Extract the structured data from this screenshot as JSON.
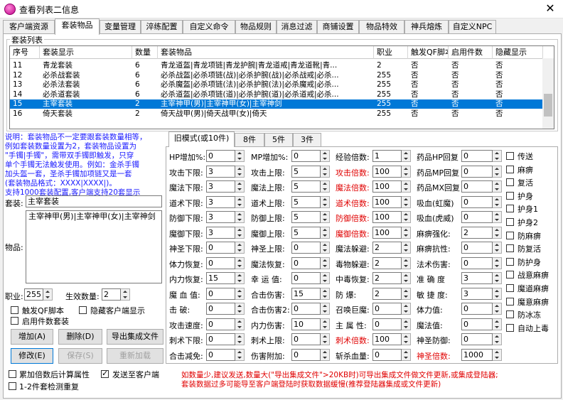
{
  "window": {
    "title": "查看列表二信息",
    "close": "✕"
  },
  "tabs": [
    "客户端资源",
    "套装物品",
    "变量管理",
    "淬练配置",
    "自定义命令",
    "物品规则",
    "消息过滤",
    "商铺设置",
    "物品特效",
    "神兵熔炼",
    "自定义NPC"
  ],
  "active_tab": "套装物品",
  "suit_list": {
    "title": "套装列表",
    "columns": [
      "序号",
      "套装显示",
      "数量",
      "套装物品",
      "职业",
      "触发QF脚本",
      "启用件数",
      "隐藏显示"
    ],
    "rows": [
      {
        "id": "11",
        "name": "青龙套装",
        "count": "6",
        "items": "青龙道盔|青龙项链|青龙护腕|青龙道戒|青龙道靴|青...",
        "job": "2",
        "qf": "否",
        "enable": "否",
        "hide": "否",
        "selected": false
      },
      {
        "id": "12",
        "name": "必杀战套装",
        "count": "6",
        "items": "必杀战盔|必杀项链(战)|必杀护腕(战)|必杀战戒|必杀...",
        "job": "255",
        "qf": "否",
        "enable": "否",
        "hide": "否",
        "selected": false
      },
      {
        "id": "13",
        "name": "必杀法套装",
        "count": "6",
        "items": "必杀魔盔|必杀项链(法)|必杀护腕(法)|必杀魔戒|必杀...",
        "job": "255",
        "qf": "否",
        "enable": "否",
        "hide": "否",
        "selected": false
      },
      {
        "id": "14",
        "name": "必杀道套装",
        "count": "6",
        "items": "必杀道盔|必杀项链(道)|必杀护腕(道)|必杀道戒|必杀...",
        "job": "255",
        "qf": "否",
        "enable": "否",
        "hide": "否",
        "selected": false
      },
      {
        "id": "15",
        "name": "主宰套装",
        "count": "2",
        "items": "主宰神甲(男)|主宰神甲(女)|主宰神剑",
        "job": "255",
        "qf": "否",
        "enable": "否",
        "hide": "否",
        "selected": true
      },
      {
        "id": "16",
        "name": "倚天套装",
        "count": "2",
        "items": "倚天战甲(男)|倚天战甲(女)|倚天",
        "job": "255",
        "qf": "否",
        "enable": "否",
        "hide": "否",
        "selected": false
      }
    ]
  },
  "tip_lines": [
    "说明：套装物品不一定要跟套装数量相等，",
    "例如套装数量设置为2，套装物品设置为",
    "\"手镯|手镯\"，需带双手镯即触发，只穿",
    "单个手镯无法触发使用。例如：金杀手镯",
    "加头盔一套，圣杀手镯加项链又是一套",
    "(套装物品格式：XXXX|XXXX|)。",
    "支持1000套装配置,客户端支持20套显示"
  ],
  "form": {
    "suit_label": "套装:",
    "suit_value": "主宰套装",
    "items_label": "物品:",
    "items_value": "主宰神甲(男)|主宰神甲(女)|主宰神剑",
    "job_label": "职业:",
    "job_value": "255",
    "effect_label": "生效数量:",
    "effect_value": "2",
    "chk_qf": "触发QF脚本",
    "chk_hide": "隐藏客户端显示",
    "chk_enable": "启用件数套装",
    "btn_add": "增加(A)",
    "btn_del": "删除(D)",
    "btn_export": "导出集成文件",
    "btn_edit": "修改(E)",
    "btn_save": "保存(S)",
    "btn_reload": "重新加载",
    "chk_accum": "累加倍数后计算属性",
    "chk_send": "发送至客户端",
    "chk_redetect": "1-2件套检测重复"
  },
  "subtabs": [
    "旧模式(或10件)",
    "8件",
    "5件",
    "3件"
  ],
  "attrs": {
    "col1": [
      [
        "HP增加%:",
        "0"
      ],
      [
        "攻击下限:",
        "3"
      ],
      [
        "魔法下限:",
        "3"
      ],
      [
        "道术下限:",
        "3"
      ],
      [
        "防御下限:",
        "3"
      ],
      [
        "魔御下限:",
        "3"
      ],
      [
        "神圣下限:",
        "0"
      ],
      [
        "体力恢复:",
        "0"
      ],
      [
        "内力恢复:",
        "15"
      ],
      [
        "魔 血 值:",
        "0"
      ],
      [
        "击      破:",
        "0"
      ],
      [
        "攻击速度:",
        "0"
      ],
      [
        "刺术下限:",
        "0"
      ],
      [
        "合击减免:",
        "0"
      ]
    ],
    "col2": [
      [
        "MP增加%:",
        "0"
      ],
      [
        "攻击上限:",
        "5"
      ],
      [
        "魔法上限:",
        "5"
      ],
      [
        "道术上限:",
        "5"
      ],
      [
        "防御上限:",
        "5"
      ],
      [
        "魔御上限:",
        "5"
      ],
      [
        "神圣上限:",
        "0"
      ],
      [
        "魔法恢复:",
        "0"
      ],
      [
        "幸 运 值:",
        "0"
      ],
      [
        "合击伤害:",
        "15"
      ],
      [
        "合击伤害2:",
        "0"
      ],
      [
        "内力伤害:",
        "10"
      ],
      [
        "刺术上限:",
        "0"
      ],
      [
        "伤害附加:",
        "0"
      ]
    ],
    "col3": [
      [
        "经验倍数:",
        "1"
      ],
      [
        "攻击倍数:",
        "100"
      ],
      [
        "魔法倍数:",
        "100"
      ],
      [
        "道术倍数:",
        "100"
      ],
      [
        "防御倍数:",
        "100"
      ],
      [
        "魔御倍数:",
        "100"
      ],
      [
        "魔法躲避:",
        "2"
      ],
      [
        "毒物躲避:",
        "2"
      ],
      [
        "中毒恢复:",
        "2"
      ],
      [
        "防      爆:",
        "2"
      ],
      [
        "召唤巨魔:",
        "0"
      ],
      [
        "主 属 性:",
        "0"
      ],
      [
        "刺术倍数:",
        "100"
      ],
      [
        "斩杀血量:",
        "0"
      ]
    ],
    "col3_red": [
      false,
      true,
      true,
      true,
      true,
      true,
      false,
      false,
      false,
      false,
      false,
      false,
      true,
      false
    ],
    "col4": [
      [
        "药品HP回复",
        "0"
      ],
      [
        "药品MP回复",
        "0"
      ],
      [
        "药品MX回复",
        "0"
      ],
      [
        "吸血(虹魔)",
        "0"
      ],
      [
        "吸血(虎威)",
        "0"
      ],
      [
        "麻痹强化:",
        "2"
      ],
      [
        "麻痹抗性:",
        "0"
      ],
      [
        "法术伤害:",
        "0"
      ],
      [
        "准 确 度",
        "3"
      ],
      [
        "敏 捷 度:",
        "3"
      ],
      [
        "体力值:",
        "0"
      ],
      [
        "魔法值:",
        "0"
      ],
      [
        "神圣防御:",
        "0"
      ],
      [
        "神圣倍数:",
        "1000"
      ]
    ],
    "col4_red": [
      false,
      false,
      false,
      false,
      false,
      false,
      false,
      false,
      false,
      false,
      false,
      false,
      false,
      true
    ],
    "checks": [
      "传送",
      "麻痹",
      "复活",
      "护身",
      "护身1",
      "护身2",
      "防麻痹",
      "防复活",
      "防护身",
      "战意麻痹",
      "魔道麻痹",
      "魔意麻痹",
      "防冰冻",
      "自动上毒"
    ]
  },
  "note_lines": [
    "如数量少,建议发送,数量大(\"导出集成文件\">20KB时)可导出集成文件做文件更新,或集成登陆器;",
    "套装数据过多可能导至客户端登陆时获取数据缓慢(推荐登陆器集成或文件更新)"
  ]
}
